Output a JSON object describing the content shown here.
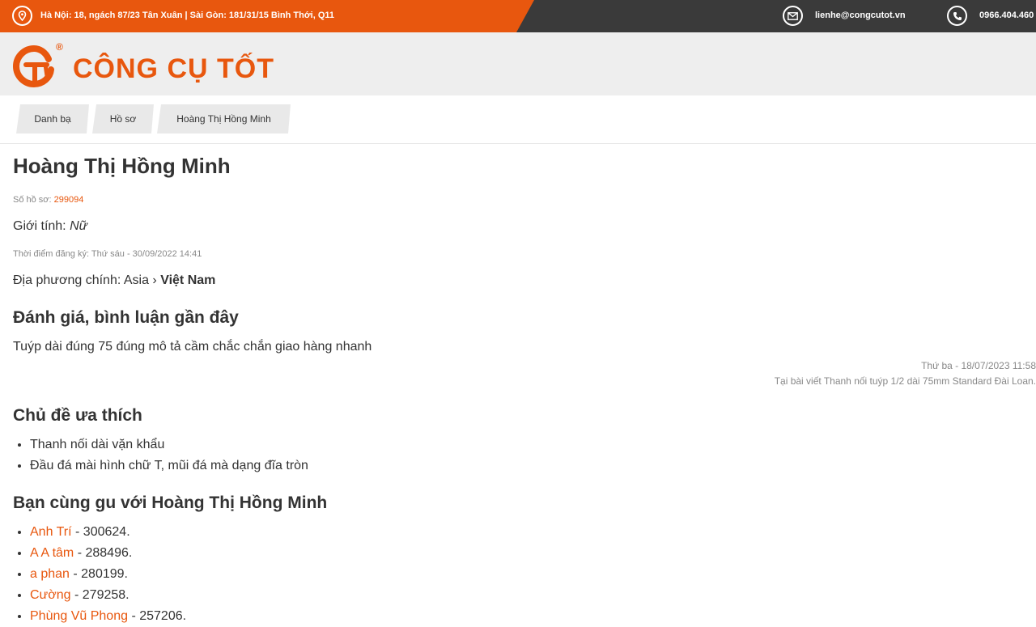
{
  "topbar": {
    "address": "Hà Nội: 18, ngách 87/23 Tân Xuân | Sài Gòn: 181/31/15 Bình Thới, Q11",
    "email": "lienhe@congcutot.vn",
    "phone": "0966.404.460",
    "icons": [
      "map-pin-icon",
      "mail-icon",
      "phone-icon"
    ],
    "colors": {
      "accent": "#e8570e",
      "dark": "#3a3a3a"
    }
  },
  "header": {
    "logo_text": "CÔNG CỤ TỐT",
    "registered_mark": "®"
  },
  "breadcrumbs": [
    "Danh bạ",
    "Hồ sơ",
    "Hoàng Thị Hồng Minh"
  ],
  "profile": {
    "name": "Hoàng Thị Hồng Minh",
    "id_label": "Số hồ sơ:",
    "id_value": "299094",
    "gender_label": "Giới tính:",
    "gender_value": "Nữ",
    "registered_label": "Thời điểm đăng ký:",
    "registered_value": "Thứ sáu - 30/09/2022 14:41",
    "location_label": "Địa phương chính:",
    "location_region": "Asia",
    "location_sep": "›",
    "location_country": "Việt Nam"
  },
  "reviews": {
    "title": "Đánh giá, bình luận gần đây",
    "items": [
      {
        "text": "Tuýp dài đúng 75 đúng mô tả cầm chắc chắn giao hàng nhanh",
        "date": "Thứ ba - 18/07/2023 11:58",
        "source": "Tại bài viết Thanh nối tuýp 1/2 dài 75mm Standard Đài Loan."
      }
    ]
  },
  "topics": {
    "title": "Chủ đề ưa thích",
    "items": [
      "Thanh nối dài vặn khẩu",
      "Đầu đá mài hình chữ T, mũi đá mà dạng đĩa tròn"
    ]
  },
  "friends": {
    "title": "Bạn cùng gu với Hoàng Thị Hồng Minh",
    "items": [
      {
        "name": "Anh Trí",
        "id": "300624."
      },
      {
        "name": "A A tâm",
        "id": "288496."
      },
      {
        "name": "a phan",
        "id": "280199."
      },
      {
        "name": "Cường",
        "id": "279258."
      },
      {
        "name": "Phùng Vũ Phong",
        "id": "257206."
      }
    ],
    "separator": " - "
  }
}
